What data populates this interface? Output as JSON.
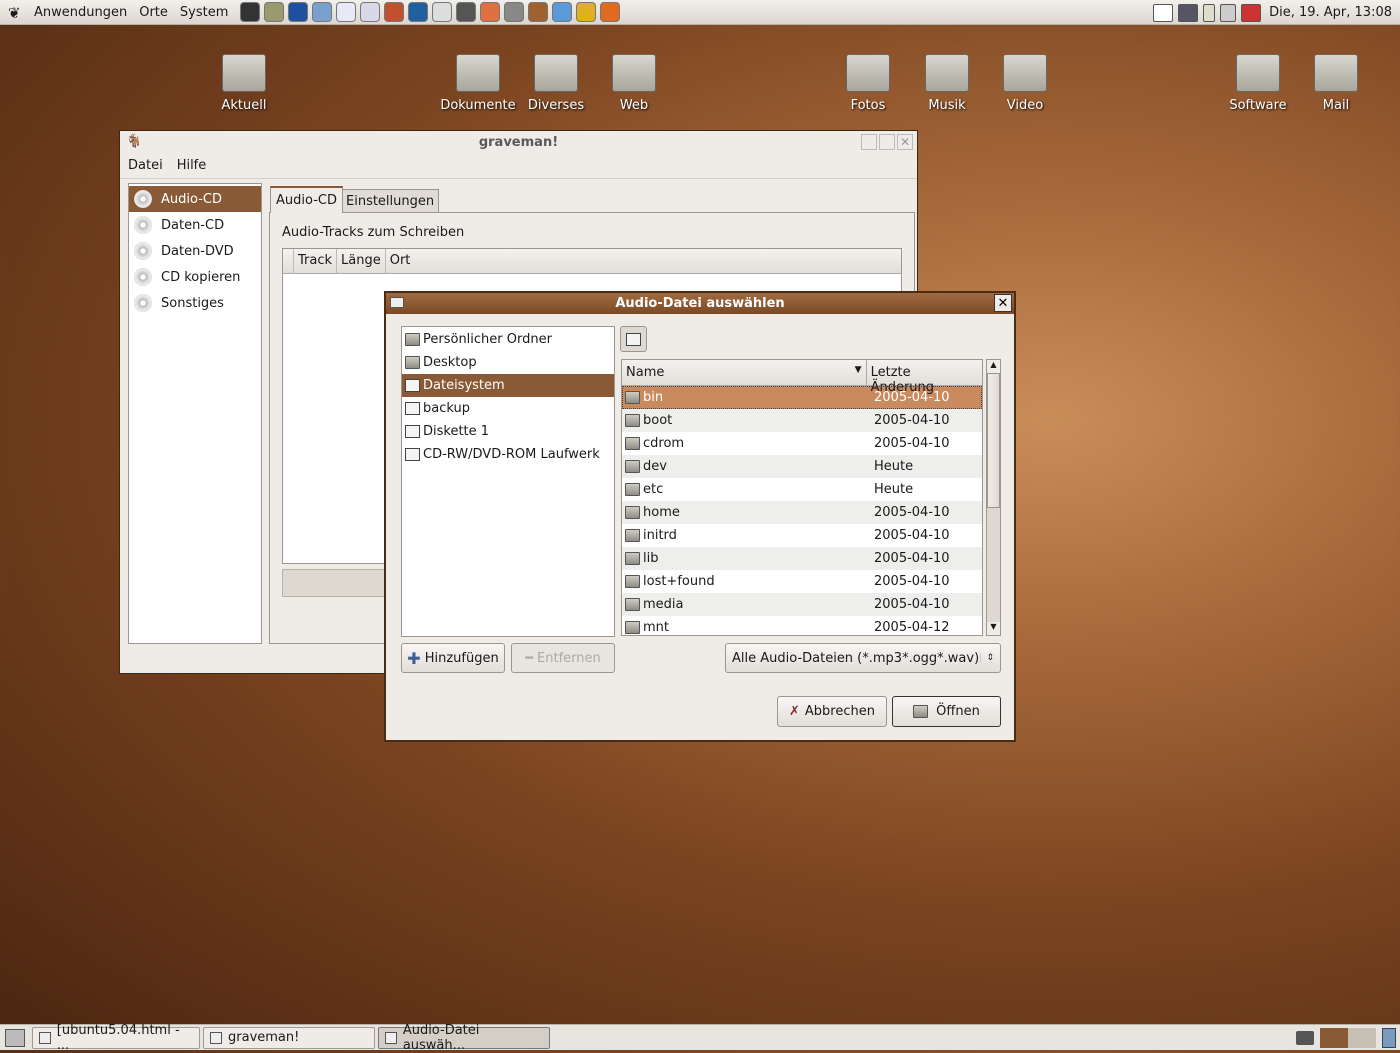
{
  "top_panel": {
    "menus": [
      "Anwendungen",
      "Orte",
      "System"
    ],
    "launchers": [
      "terminal-icon",
      "notes-icon",
      "browser-icon",
      "mail-icon",
      "document-icon",
      "editor-icon",
      "image-viewer-icon",
      "media-icon",
      "screenshot-icon",
      "gimp-icon",
      "app-icon",
      "calculator-icon",
      "video-icon",
      "chat-icon",
      "user-icon",
      "skype-icon"
    ],
    "tray": [
      "mail-icon",
      "network-icon",
      "power-icon",
      "volume-icon",
      "logout-icon"
    ],
    "clock": "Die, 19. Apr, 13:08"
  },
  "desktop_icons": [
    "Aktuell",
    "Dokumente",
    "Diverses",
    "Web",
    "Fotos",
    "Musik",
    "Video",
    "Software",
    "Mail"
  ],
  "graveman": {
    "title": "graveman!",
    "menu": [
      "Datei",
      "Hilfe"
    ],
    "sidebar": [
      "Audio-CD",
      "Daten-CD",
      "Daten-DVD",
      "CD kopieren",
      "Sonstiges"
    ],
    "sidebar_selected": 0,
    "tabs": [
      "Audio-CD",
      "Einstellungen"
    ],
    "section_label": "Audio-Tracks zum Schreiben",
    "columns": [
      "Track",
      "Länge",
      "Ort"
    ]
  },
  "dialog": {
    "title": "Audio-Datei auswählen",
    "places": [
      "Persönlicher Ordner",
      "Desktop",
      "Dateisystem",
      "backup",
      "Diskette 1",
      "CD-RW/DVD-ROM Laufwerk"
    ],
    "places_selected": 2,
    "columns": [
      "Name",
      "Letzte Änderung"
    ],
    "files": [
      {
        "name": "bin",
        "date": "2005-04-10"
      },
      {
        "name": "boot",
        "date": "2005-04-10"
      },
      {
        "name": "cdrom",
        "date": "2005-04-10"
      },
      {
        "name": "dev",
        "date": "Heute"
      },
      {
        "name": "etc",
        "date": "Heute"
      },
      {
        "name": "home",
        "date": "2005-04-10"
      },
      {
        "name": "initrd",
        "date": "2005-04-10"
      },
      {
        "name": "lib",
        "date": "2005-04-10"
      },
      {
        "name": "lost+found",
        "date": "2005-04-10"
      },
      {
        "name": "media",
        "date": "2005-04-10"
      },
      {
        "name": "mnt",
        "date": "2005-04-12"
      }
    ],
    "files_selected": 0,
    "add_label": "Hinzufügen",
    "remove_label": "Entfernen",
    "filter": "Alle Audio-Dateien (*.mp3*.ogg*.wav)",
    "cancel_label": "Abbrechen",
    "open_label": "Öffnen"
  },
  "taskbar": {
    "tasks": [
      "[ubuntu5.04.html - ...",
      "graveman!",
      "Audio-Datei auswäh..."
    ],
    "active": 2
  },
  "colors": {
    "accent": "#8a5a36",
    "selection": "#c98a5e",
    "title_dark": "#6b4322"
  }
}
